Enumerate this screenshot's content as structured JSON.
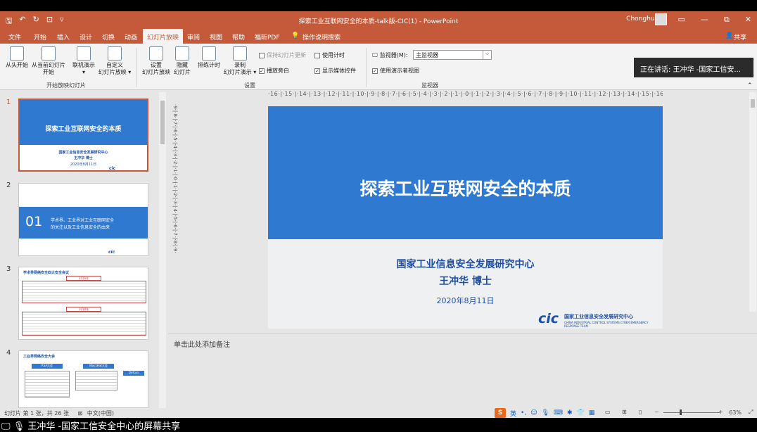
{
  "window": {
    "title": "探索工业互联网安全的本质-talk版-CIC(1) - PowerPoint",
    "user": "Chonghua",
    "qat": [
      "🖫",
      "↶",
      "↻",
      "⊡",
      "▿"
    ],
    "controls": [
      "▭",
      "—",
      "⧉",
      "✕"
    ]
  },
  "ribbon_tabs": [
    "文件",
    "开始",
    "插入",
    "设计",
    "切换",
    "动画",
    "幻灯片放映",
    "审阅",
    "视图",
    "帮助",
    "福昕PDF",
    "操作说明搜索",
    "共享"
  ],
  "ribbon": {
    "group1": {
      "buttons": [
        {
          "label1": "从头开始",
          "label2": ""
        },
        {
          "label1": "从当前幻灯片",
          "label2": "开始"
        },
        {
          "label1": "联机演示",
          "label2": "▾"
        },
        {
          "label1": "自定义",
          "label2": "幻灯片放映 ▾"
        }
      ],
      "label": "开始放映幻灯片"
    },
    "group2": {
      "buttons": [
        {
          "label1": "设置",
          "label2": "幻灯片放映"
        },
        {
          "label1": "隐藏",
          "label2": "幻灯片"
        },
        {
          "label1": "排练计时",
          "label2": ""
        },
        {
          "label1": "录制",
          "label2": "幻灯片演示 ▾"
        }
      ],
      "checks": [
        {
          "label": "保持幻灯片更新",
          "checked": false,
          "disabled": true
        },
        {
          "label": "使用计时",
          "checked": false,
          "disabled": false
        },
        {
          "label": "播放旁白",
          "checked": true,
          "disabled": false
        },
        {
          "label": "显示媒体控件",
          "checked": true,
          "disabled": false
        }
      ],
      "label": "设置"
    },
    "group3": {
      "monitor_label": "监视器(M):",
      "monitor_value": "主监视器",
      "presenter_view": "使用演示者视图",
      "presenter_checked": true,
      "label": "监视器"
    }
  },
  "presenter_banner": "正在讲话: 王冲华 -国家工信安...",
  "thumbnails": [
    {
      "num": "1",
      "title": "探索工业互联网安全的本质",
      "org": "国家工业信息安全发展研究中心",
      "author": "王冲华  博士",
      "date": "2020年8月11日"
    },
    {
      "num": "2",
      "chapter": "01",
      "text1": "学术界、工业界对工业互联网安全",
      "text2": "的关注以及工业信息安全的由来"
    },
    {
      "num": "3",
      "heading": "学术界网络安全四大安全会议",
      "year1": "2019年",
      "year2": "2018年"
    },
    {
      "num": "4",
      "heading": "工业界网络安全大会",
      "b1": "RSA大会",
      "b2": "BlackHat大会",
      "b3": "Defcon"
    }
  ],
  "ruler": {
    "h": "·16·|·15·|·14·|·13·|·12·|·11·|·10·|·9·|·8·|·7·|·6·|·5·|·4·|·3·|·2·|·1·|·0·|·1·|·2·|·3·|·4·|·5·|·6·|·7·|·8·|·9·|·10·|·11·|·12·|·13·|·14·|·15·|·16·",
    "v": "·9·|·8·|·7·|·6·|·5·|·4·|·3·|·2·|·1·|·0·|·1·|·2·|·3·|·4·|·5·|·6·|·7·|·8·|·9·"
  },
  "slide": {
    "title": "探索工业互联网安全的本质",
    "org": "国家工业信息安全发展研究中心",
    "author": "王冲华  博士",
    "date": "2020年8月11日",
    "logo": "cic",
    "logo_text": "国家工业信息安全发展研究中心",
    "logo_sub": "CHINA INDUSTRIAL CONTROL SYSTEMS CYBER EMERGENCY RESPONSE TEAM"
  },
  "notes_placeholder": "单击此处添加备注",
  "status": {
    "slide_info": "幻灯片 第 1 张，共 26 张",
    "language": "中文(中国)",
    "zoom": "63%"
  },
  "ime": {
    "mode": "英"
  },
  "sharebar": "王冲华 -国家工信安全中心的屏幕共享",
  "colors": {
    "accent": "#c55a3a",
    "slide_blue": "#2f7ad0",
    "text_blue": "#1f4fa3"
  }
}
